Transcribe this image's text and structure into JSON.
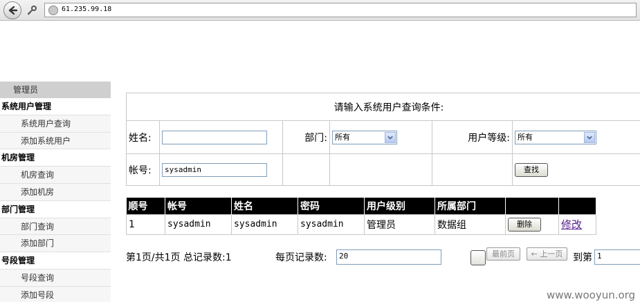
{
  "browser": {
    "url": "61.235.99.18"
  },
  "sidebar": {
    "header": "管理员",
    "groups": [
      {
        "title": "系统用户管理",
        "items": [
          "系统用户查询",
          "添加系统用户"
        ]
      },
      {
        "title": "机房管理",
        "items": [
          "机房查询",
          "添加机房"
        ]
      },
      {
        "title": "部门管理",
        "items": [
          "部门查询",
          "添加部门"
        ]
      },
      {
        "title": "号段管理",
        "items": [
          "号段查询",
          "添加号段"
        ]
      }
    ]
  },
  "query": {
    "title": "请输入系统用户查询条件:",
    "name_label": "姓名:",
    "name_value": "",
    "dept_label": "部门:",
    "dept_selected": "所有",
    "level_label": "用户等级:",
    "level_selected": "所有",
    "account_label": "帐号:",
    "account_value": "sysadmin",
    "search_button": "查找"
  },
  "results": {
    "headers": [
      "顺号",
      "帐号",
      "姓名",
      "密码",
      "用户级别",
      "所属部门",
      "",
      ""
    ],
    "rows": [
      {
        "no": "1",
        "account": "sysadmin",
        "name": "sysadmin",
        "password": "sysadmin",
        "level": "管理员",
        "dept": "数据组",
        "delete": "删除",
        "edit": "修改"
      }
    ]
  },
  "pager": {
    "info": "第1页/共1页 总记录数:1",
    "per_page_label": "每页记录数:",
    "per_page_value": "20",
    "last_page": "最前页",
    "prev_page": "← 上一页",
    "goto_label": "到第",
    "goto_value": "1"
  },
  "watermark": "www.wooyun.org"
}
